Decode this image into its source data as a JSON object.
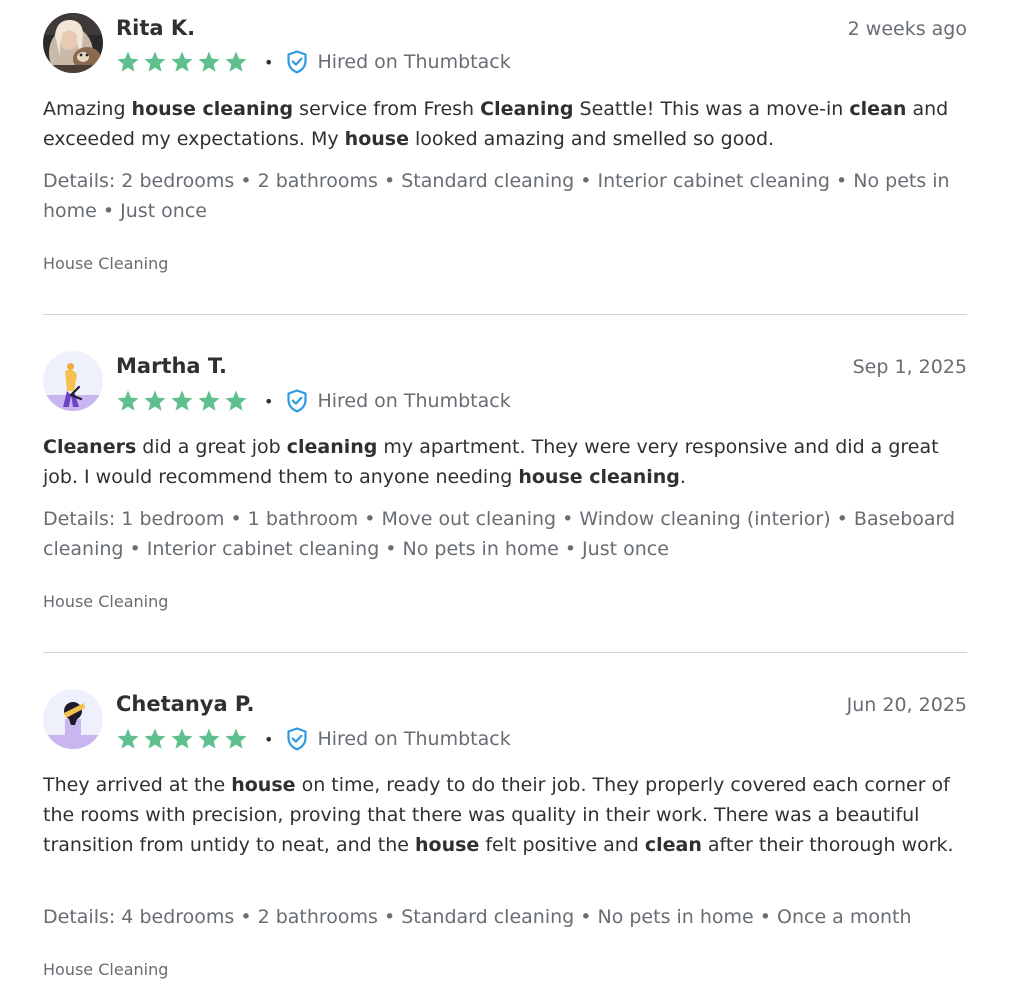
{
  "reviews": [
    {
      "reviewer": "Rita K.",
      "date": "2 weeks ago",
      "rating": 5,
      "hired_label": "Hired on Thumbtack",
      "separator": "•",
      "body": [
        {
          "t": "Amazing "
        },
        {
          "t": "house cleaning",
          "b": true
        },
        {
          "t": " service from Fresh "
        },
        {
          "t": "Cleaning",
          "b": true
        },
        {
          "t": " Seattle! This was a move-in "
        },
        {
          "t": "clean",
          "b": true
        },
        {
          "t": " and exceeded my expectations. My "
        },
        {
          "t": "house",
          "b": true
        },
        {
          "t": " looked amazing and smelled so good."
        }
      ],
      "details": "Details: 2 bedrooms • 2 bathrooms • Standard cleaning • Interior cabinet cleaning • No pets in home • Just once",
      "category": "House Cleaning",
      "avatar": "photo-avatar"
    },
    {
      "reviewer": "Martha T.",
      "date": "Sep 1, 2025",
      "rating": 5,
      "hired_label": "Hired on Thumbtack",
      "separator": "•",
      "body": [
        {
          "t": "Cleaners",
          "b": true
        },
        {
          "t": " did a great job "
        },
        {
          "t": "cleaning",
          "b": true
        },
        {
          "t": " my apartment. They were very responsive and did a great job. I would recommend them to anyone needing "
        },
        {
          "t": "house cleaning",
          "b": true
        },
        {
          "t": "."
        }
      ],
      "details": "Details: 1 bedroom • 1 bathroom • Move out cleaning • Window cleaning (interior) • Baseboard cleaning • Interior cabinet cleaning • No pets in home • Just once",
      "category": "House Cleaning",
      "avatar": "illustrated-avatar"
    },
    {
      "reviewer": "Chetanya P.",
      "date": "Jun 20, 2025",
      "rating": 5,
      "hired_label": "Hired on Thumbtack",
      "separator": "•",
      "body": [
        {
          "t": "They arrived at the "
        },
        {
          "t": "house",
          "b": true
        },
        {
          "t": " on time, ready to do their job. They properly covered each corner of the rooms with precision, proving that there was quality in their work. There was a beautiful transition from untidy to neat, and the "
        },
        {
          "t": "house",
          "b": true
        },
        {
          "t": " felt positive and "
        },
        {
          "t": "clean",
          "b": true
        },
        {
          "t": " after their thorough work."
        }
      ],
      "details": "Details: 4 bedrooms • 2 bathrooms • Standard cleaning • No pets in home • Once a month",
      "category": "House Cleaning",
      "avatar": "illustrated-avatar"
    }
  ],
  "icons": {
    "star": "star-icon",
    "verified": "shield-check-icon"
  },
  "colors": {
    "star": "#5fbf8d",
    "verified": "#2f9be0",
    "text": "#2f3033",
    "muted": "#676d73",
    "divider": "#d3d4d5"
  }
}
